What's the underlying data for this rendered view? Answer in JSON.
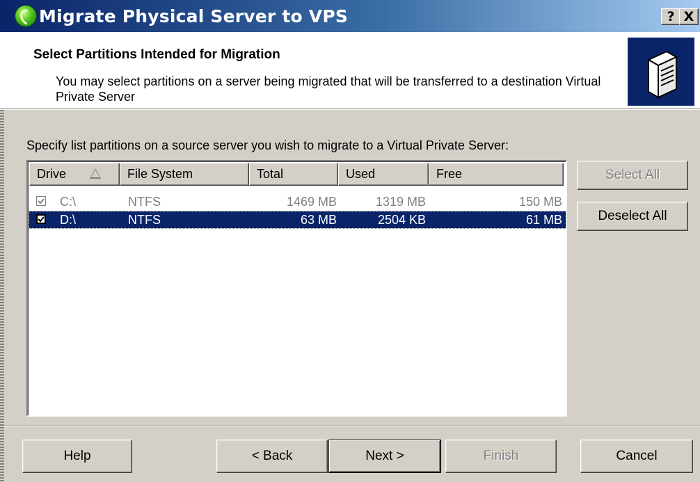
{
  "window": {
    "title": "Migrate Physical Server to VPS",
    "help_button": "?",
    "close_button": "X"
  },
  "header": {
    "title": "Select Partitions Intended for Migration",
    "subtitle": "You may select partitions on a server being migrated that will be transferred to a destination Virtual Private Server"
  },
  "instruction": "Specify list partitions on a source server you wish to migrate to a Virtual Private Server:",
  "table": {
    "columns": [
      "Drive",
      "File System",
      "Total",
      "Used",
      "Free"
    ],
    "sort_column": "Drive",
    "sort_direction": "ascending",
    "rows": [
      {
        "drive": "C:\\",
        "fs": "NTFS",
        "total": "1469 MB",
        "used": "1319 MB",
        "free": "150 MB",
        "checked": true,
        "enabled": false,
        "selected": false
      },
      {
        "drive": "D:\\",
        "fs": "NTFS",
        "total": "63 MB",
        "used": "2504 KB",
        "free": "61 MB",
        "checked": true,
        "enabled": true,
        "selected": true
      }
    ]
  },
  "side_buttons": {
    "select_all": "Select All",
    "deselect_all": "Deselect All"
  },
  "footer_buttons": {
    "help": "Help",
    "back": "< Back",
    "next": "Next >",
    "finish": "Finish",
    "cancel": "Cancel"
  },
  "colors": {
    "selection": "#0a246a",
    "face": "#d4d0c8",
    "disabled_text": "#808080"
  }
}
